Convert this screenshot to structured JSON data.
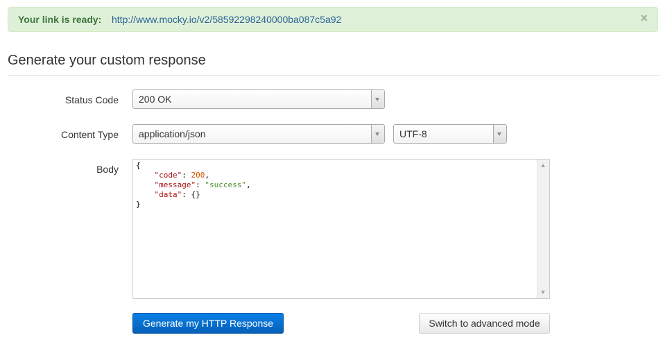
{
  "alert": {
    "label": "Your link is ready:",
    "link": "http://www.mocky.io/v2/58592298240000ba087c5a92",
    "close": "×"
  },
  "heading": "Generate your custom response",
  "form": {
    "status_label": "Status Code",
    "status_value": "200 OK",
    "content_type_label": "Content Type",
    "content_type_value": "application/json",
    "charset_value": "UTF-8",
    "body_label": "Body"
  },
  "body_code": {
    "open": "{",
    "code_key": "\"code\"",
    "code_val": "200",
    "message_key": "\"message\"",
    "message_val": "\"success\"",
    "data_key": "\"data\"",
    "data_val": "{}",
    "close": "}"
  },
  "buttons": {
    "generate": "Generate my HTTP Response",
    "advanced": "Switch to advanced mode"
  },
  "colors": {
    "alert_bg": "#dff0d8",
    "alert_text": "#3c763d",
    "link": "#2a6496",
    "primary": "#0a80e6"
  }
}
